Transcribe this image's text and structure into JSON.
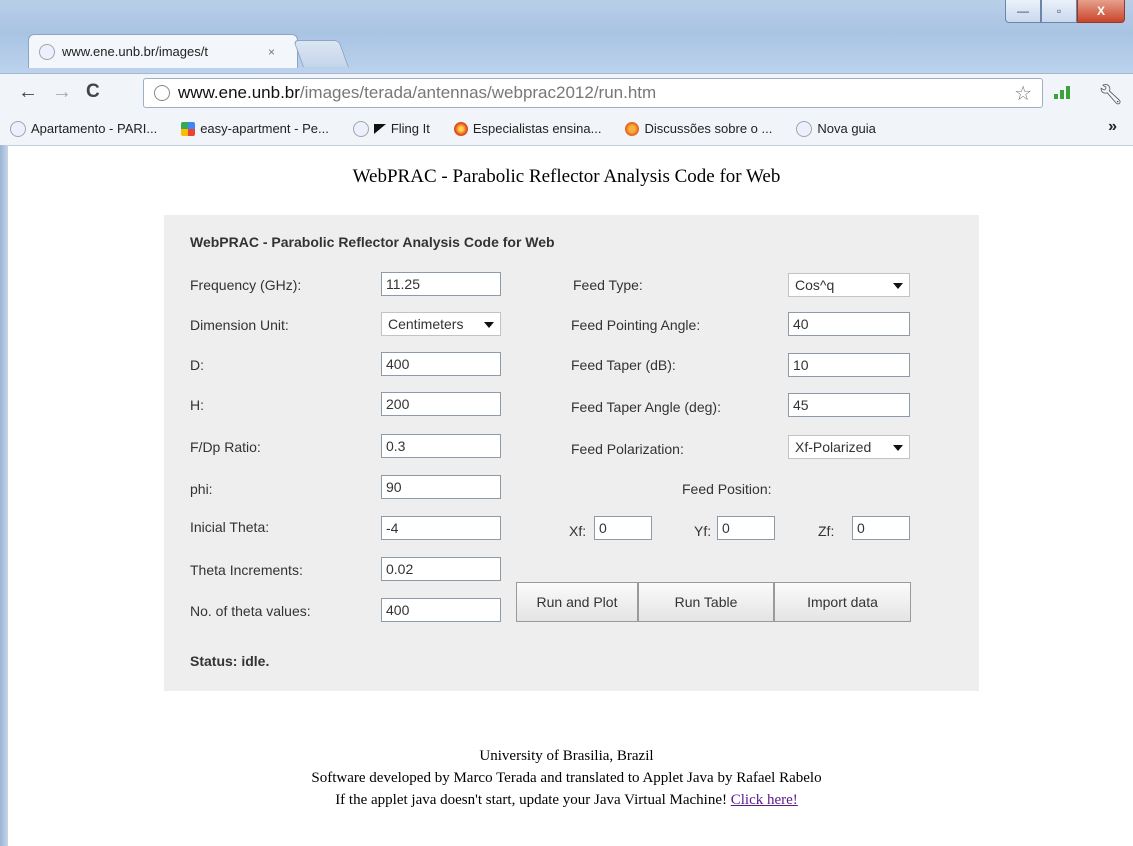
{
  "browser": {
    "tab_title": "www.ene.unb.br/images/t",
    "tab_close": "×",
    "url_host": "www.ene.unb.br",
    "url_path": "/images/terada/antennas/webprac2012/run.htm",
    "window_controls": {
      "minimize": "—",
      "maximize": "▫",
      "close": "X"
    },
    "bookmarks": [
      "Apartamento - PARI...",
      "easy-apartment - Pe...",
      "Fling It",
      "Especialistas ensina...",
      "Discussões sobre o ...",
      "Nova guia"
    ],
    "more": "»"
  },
  "page": {
    "heading": "WebPRAC - Parabolic Reflector Analysis Code for Web"
  },
  "applet": {
    "title": "WebPRAC - Parabolic Reflector Analysis Code for Web",
    "left_fields": [
      {
        "label": "Frequency (GHz):",
        "value": "11.25"
      },
      {
        "label": "Dimension Unit:",
        "value": "Centimeters"
      },
      {
        "label": "D:",
        "value": "400"
      },
      {
        "label": "H:",
        "value": "200"
      },
      {
        "label": "F/Dp Ratio:",
        "value": "0.3"
      },
      {
        "label": "phi:",
        "value": "90"
      },
      {
        "label": "Inicial Theta:",
        "value": "-4"
      },
      {
        "label": "Theta Increments:",
        "value": "0.02"
      },
      {
        "label": "No. of theta values:",
        "value": "400"
      }
    ],
    "right_fields": [
      {
        "label": "Feed Type:",
        "value": "Cos^q"
      },
      {
        "label": "Feed Pointing Angle:",
        "value": "40"
      },
      {
        "label": "Feed Taper (dB):",
        "value": "10"
      },
      {
        "label": "Feed Taper Angle (deg):",
        "value": "45"
      },
      {
        "label": "Feed Polarization:",
        "value": "Xf-Polarized"
      }
    ],
    "feed_position": {
      "label": "Feed Position:",
      "xf_label": "Xf:",
      "xf_value": "0",
      "yf_label": "Yf:",
      "yf_value": "0",
      "zf_label": "Zf:",
      "zf_value": "0"
    },
    "buttons": {
      "run_plot": "Run and Plot",
      "run_table": "Run Table",
      "import": "Import data"
    },
    "status": "Status: idle."
  },
  "footer": {
    "line1": "University of Brasilia, Brazil",
    "line2": "Software developed by Marco Terada and translated to Applet Java by Rafael Rabelo",
    "line3": "If the applet java doesn't start, update your Java Virtual Machine!",
    "link": "Click here!"
  }
}
